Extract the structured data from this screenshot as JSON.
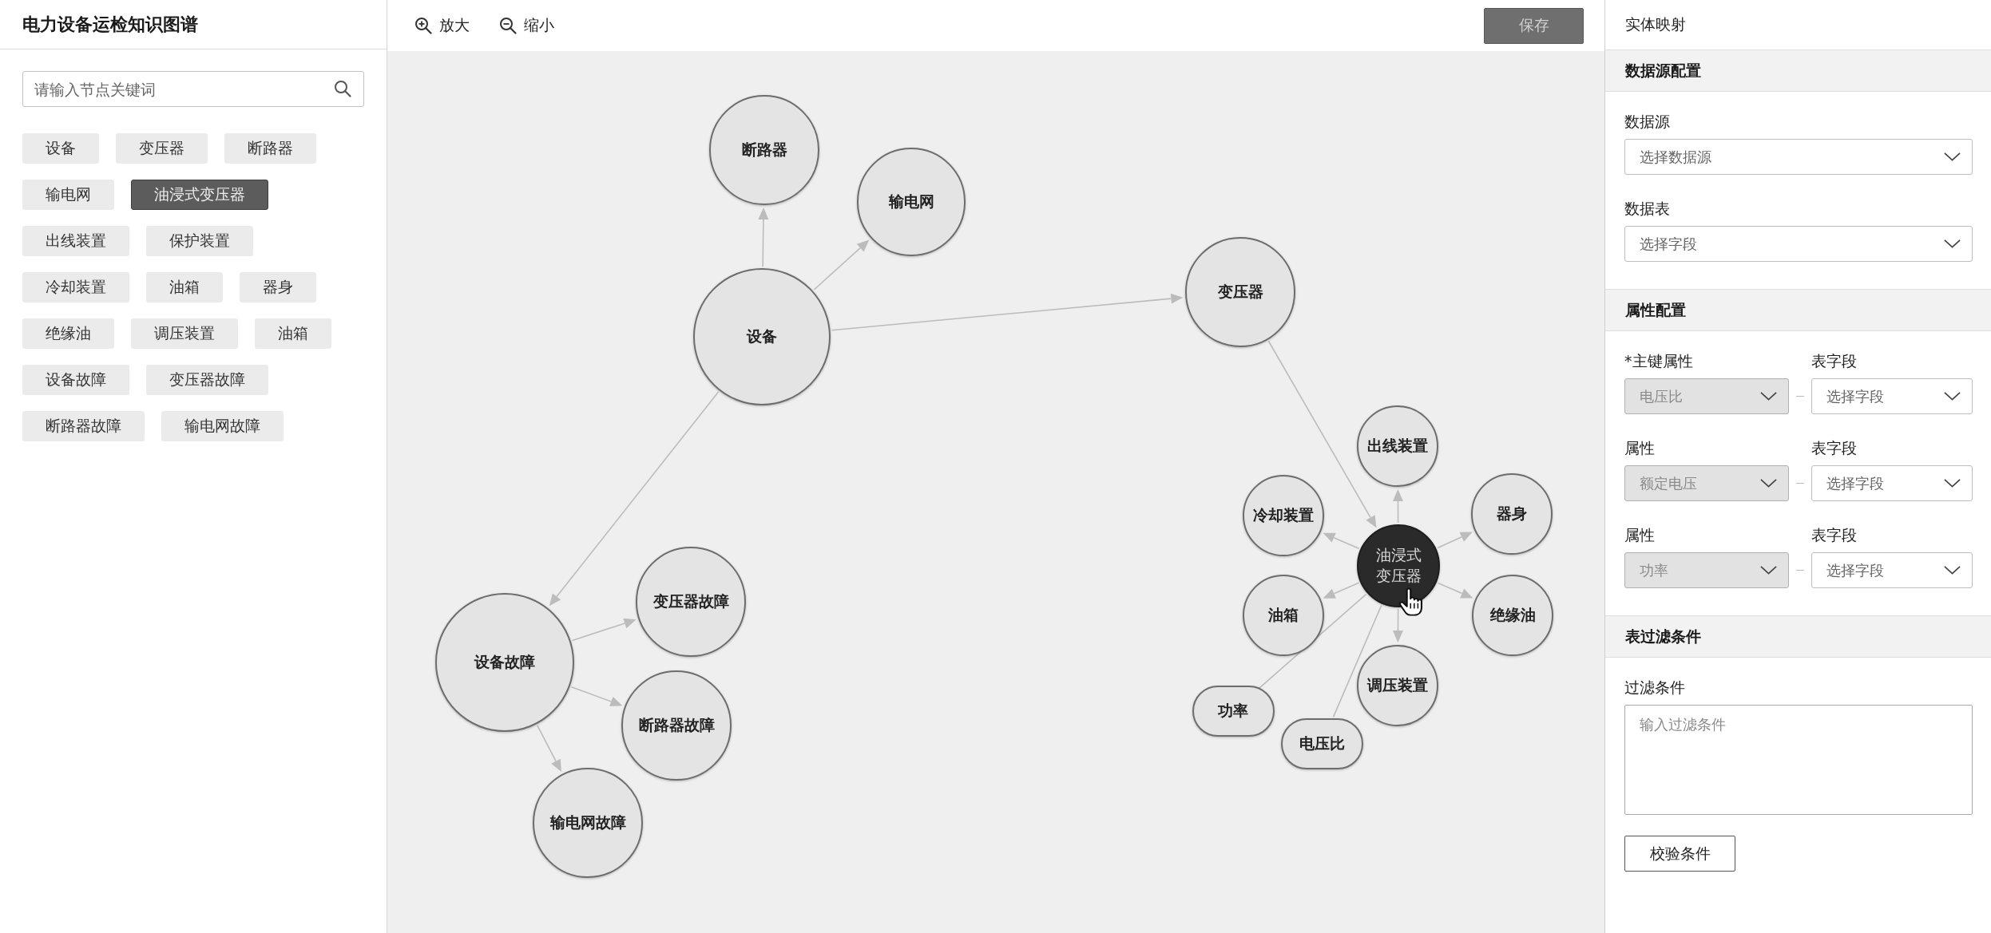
{
  "app": {
    "title": "电力设备运检知识图谱"
  },
  "sidebar": {
    "search": {
      "placeholder": "请输入节点关键词"
    },
    "tags": [
      {
        "label": "设备",
        "selected": false
      },
      {
        "label": "变压器",
        "selected": false
      },
      {
        "label": "断路器",
        "selected": false
      },
      {
        "label": "输电网",
        "selected": false
      },
      {
        "label": "油浸式变压器",
        "selected": true
      },
      {
        "label": "出线装置",
        "selected": false
      },
      {
        "label": "保护装置",
        "selected": false
      },
      {
        "label": "冷却装置",
        "selected": false
      },
      {
        "label": "油箱",
        "selected": false
      },
      {
        "label": "器身",
        "selected": false
      },
      {
        "label": "绝缘油",
        "selected": false
      },
      {
        "label": "调压装置",
        "selected": false
      },
      {
        "label": "油箱",
        "selected": false
      },
      {
        "label": "设备故障",
        "selected": false
      },
      {
        "label": "变压器故障",
        "selected": false
      },
      {
        "label": "断路器故障",
        "selected": false
      },
      {
        "label": "输电网故障",
        "selected": false
      }
    ]
  },
  "toolbar": {
    "buttons": [
      {
        "kind": "zoom_in",
        "label": "放大"
      },
      {
        "kind": "zoom_out",
        "label": "缩小"
      }
    ],
    "save": {
      "label": "保存"
    }
  },
  "graph": {
    "root": {
      "label": "设备",
      "kind": "entity",
      "selected": false,
      "children": [
        {
          "label": "断路器",
          "kind": "entity",
          "selected": false
        },
        {
          "label": "输电网",
          "kind": "entity",
          "selected": false
        },
        {
          "label": "变压器",
          "kind": "entity",
          "selected": false,
          "children": [
            {
              "label": "油浸式变压器",
              "kind": "entity",
              "selected": true,
              "children": [
                {
                  "label": "出线装置",
                  "kind": "entity",
                  "selected": false
                },
                {
                  "label": "冷却装置",
                  "kind": "entity",
                  "selected": false
                },
                {
                  "label": "器身",
                  "kind": "entity",
                  "selected": false
                },
                {
                  "label": "油箱",
                  "kind": "entity",
                  "selected": false
                },
                {
                  "label": "绝缘油",
                  "kind": "entity",
                  "selected": false
                },
                {
                  "label": "调压装置",
                  "kind": "entity",
                  "selected": false
                },
                {
                  "label": "功率",
                  "kind": "attribute",
                  "selected": false
                },
                {
                  "label": "电压比",
                  "kind": "attribute",
                  "selected": false
                }
              ]
            }
          ]
        },
        {
          "label": "设备故障",
          "kind": "entity",
          "selected": false,
          "children": [
            {
              "label": "变压器故障",
              "kind": "entity",
              "selected": false
            },
            {
              "label": "断路器故障",
              "kind": "entity",
              "selected": false
            },
            {
              "label": "输电网故障",
              "kind": "entity",
              "selected": false
            }
          ]
        }
      ]
    }
  },
  "mapping_panel": {
    "title": "实体映射",
    "sections": [
      {
        "kind": "selects",
        "title": "数据源配置",
        "fields": [
          {
            "label": "数据源",
            "placeholder": "选择数据源"
          },
          {
            "label": "数据表",
            "placeholder": "选择字段"
          }
        ]
      },
      {
        "kind": "attribute_rows",
        "title": "属性配置",
        "rows": [
          {
            "attribute_label": "*主键属性",
            "attribute": {
              "value": "电压比",
              "disabled": true
            },
            "field_label": "表字段",
            "field": {
              "placeholder": "选择字段",
              "disabled": false
            }
          },
          {
            "attribute_label": "属性",
            "attribute": {
              "value": "额定电压",
              "disabled": true
            },
            "field_label": "表字段",
            "field": {
              "placeholder": "选择字段",
              "disabled": false
            }
          },
          {
            "attribute_label": "属性",
            "attribute": {
              "value": "功率",
              "disabled": true
            },
            "field_label": "表字段",
            "field": {
              "placeholder": "选择字段",
              "disabled": false
            }
          }
        ]
      },
      {
        "kind": "filter",
        "title": "表过滤条件",
        "label": "过滤条件",
        "placeholder": "输入过滤条件",
        "button": "校验条件"
      }
    ]
  }
}
